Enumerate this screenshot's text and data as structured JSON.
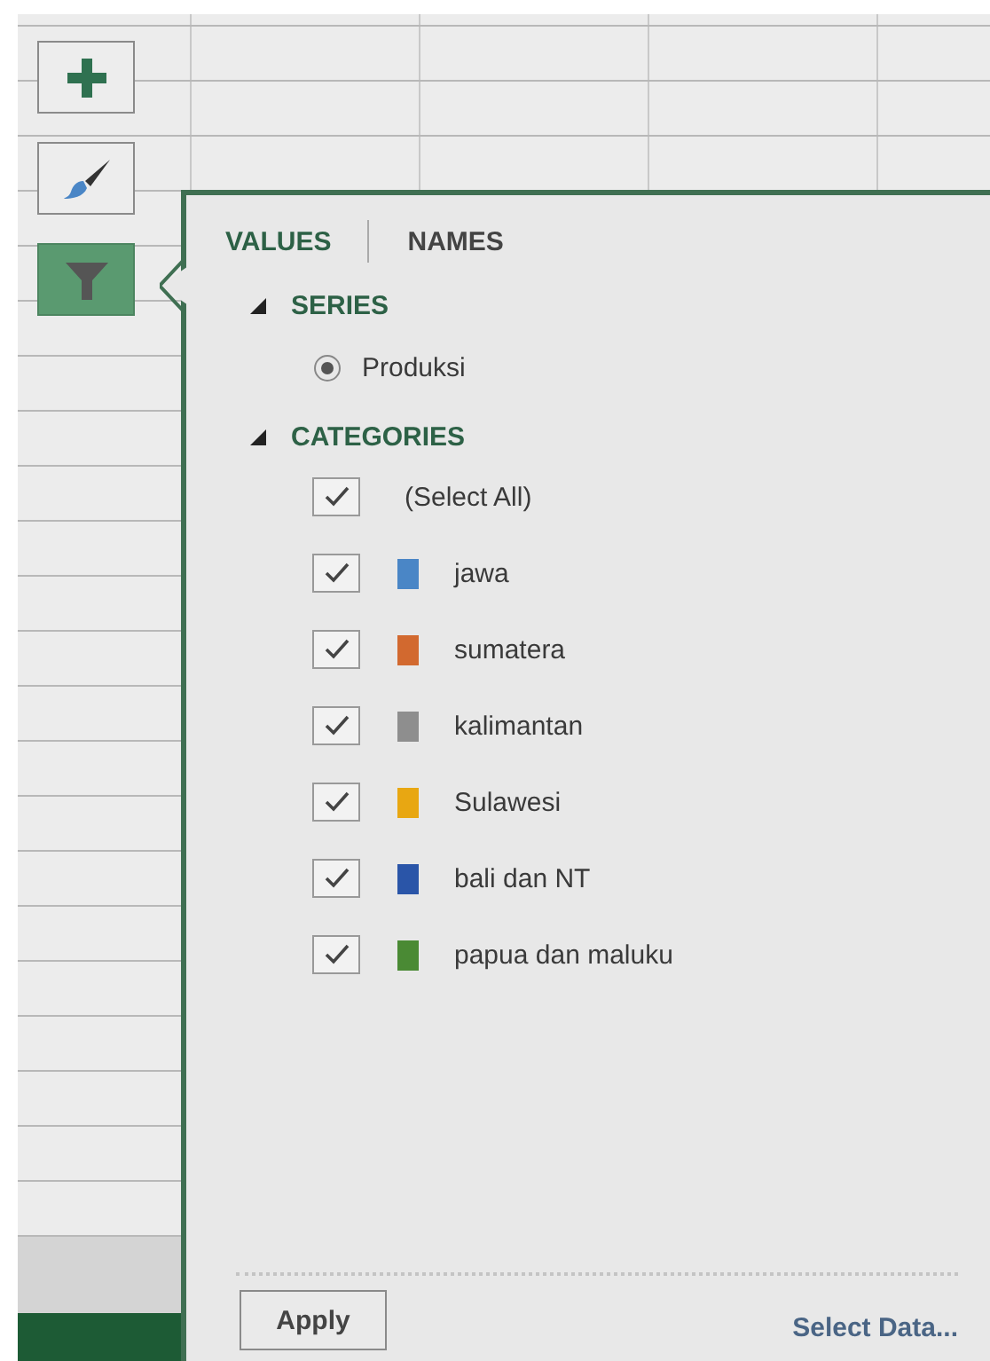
{
  "side_buttons": [
    {
      "kind": "add",
      "selected": false
    },
    {
      "kind": "style",
      "selected": false
    },
    {
      "kind": "filter",
      "selected": true
    }
  ],
  "tabs": [
    {
      "label": "VALUES",
      "selected": true
    },
    {
      "label": "NAMES",
      "selected": false
    }
  ],
  "series": {
    "title": "SERIES",
    "expanded": true,
    "items": [
      {
        "label": "Produksi",
        "selected": true
      }
    ]
  },
  "categories": {
    "title": "CATEGORIES",
    "expanded": true,
    "items": [
      {
        "label": "(Select All)",
        "checked": true
      },
      {
        "label": "jawa",
        "checked": true,
        "color": "#4a86c6"
      },
      {
        "label": "sumatera",
        "checked": true,
        "color": "#d2692f"
      },
      {
        "label": "kalimantan",
        "checked": true,
        "color": "#8e8e8e"
      },
      {
        "label": "Sulawesi",
        "checked": true,
        "color": "#e8a712"
      },
      {
        "label": "bali dan NT",
        "checked": true,
        "color": "#2a55a8"
      },
      {
        "label": "papua dan maluku",
        "checked": true,
        "color": "#4a8a34"
      }
    ]
  },
  "apply_button": "Apply",
  "select_data_link": "Select Data..."
}
